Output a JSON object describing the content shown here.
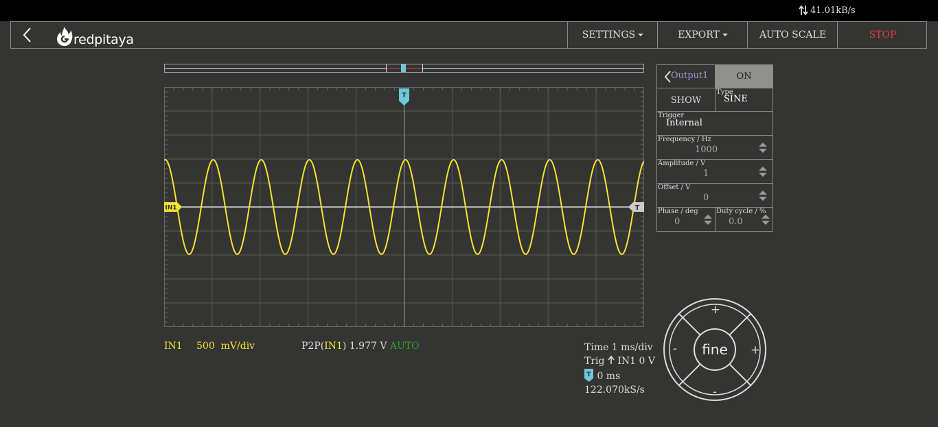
{
  "status": {
    "data_rate": "41.01kB/s"
  },
  "brand": {
    "logo_text": "redpitaya"
  },
  "menu": {
    "settings": "SETTINGS",
    "export": "EXPORT",
    "auto_scale": "AUTO SCALE",
    "stop": "STOP"
  },
  "scope": {
    "trigger_marker": "T",
    "channel_marker": "IN1",
    "trigger_level_marker": "T",
    "colors": {
      "in1": "#f5e333",
      "trigger": "#6ec8d8",
      "grid": "#5a5a58"
    }
  },
  "channel_info": {
    "name": "IN1",
    "scale_value": "500",
    "scale_unit": "mV/div",
    "measure_prefix": "P2P(",
    "measure_channel": "IN1",
    "measure_value": ") 1.977  V",
    "measure_mode": "AUTO"
  },
  "time_info": {
    "time": "Time 1 ms/div",
    "trig_prefix": "Trig",
    "trig_rest": "IN1 0 V",
    "trig_marker": "T",
    "offset": "0 ms",
    "sample_rate": "122.070kS/s"
  },
  "output_panel": {
    "output_label": "Output1",
    "on_label": "ON",
    "show_label": "SHOW",
    "type_label": "Type",
    "type_value": "SINE",
    "trigger_label": "Trigger",
    "trigger_value": "Internal",
    "frequency_label": "Frequency   / Hz",
    "frequency_value": "1000",
    "amplitude_label": "Amplitude / V",
    "amplitude_value": "1",
    "offset_label": "Offset  / V",
    "offset_value": "0",
    "phase_label": "Phase   / deg",
    "phase_value": "0",
    "duty_label": "Duty cycle  / %",
    "duty_value": "0.0"
  },
  "joystick": {
    "center_label": "fine",
    "up_label": "+",
    "down_label": "-",
    "left_label": "-",
    "right_label": "+"
  }
}
